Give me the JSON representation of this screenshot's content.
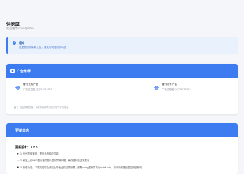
{
  "header": {
    "title": "仪表盘",
    "subtitle": "欢迎使用IconsApi Pro"
  },
  "notice": {
    "title": "通知",
    "text": "这里是系统最新公告，请及时关注系统动态"
  },
  "ads": {
    "title": "广告推荐",
    "items": [
      {
        "title": "暂时无有广告",
        "sub": "广告位招租 QQ715715163"
      },
      {
        "title": "暂时无有广告",
        "sub": "广告位招租 QQ715715163"
      }
    ],
    "note": "广告位长期出租，请联系客服获取更多合作详情信息"
  },
  "changelog": {
    "title": "更新日志",
    "version": "更新版本： 1.7.0",
    "items": [
      "1. 优化整体速度，提升系统响应性能",
      "2. 修复上传PNG图标格式图片显示异常问题，确保图标能正常展示",
      "3. 新增功能，下载安装时会读取上传地址的目录设置，无需config重写并执行install.lock，访问新的路径重启安装即可"
    ]
  },
  "colors": {
    "accent": "#3d7cf0",
    "notice_bg": "#e9f1fd"
  }
}
